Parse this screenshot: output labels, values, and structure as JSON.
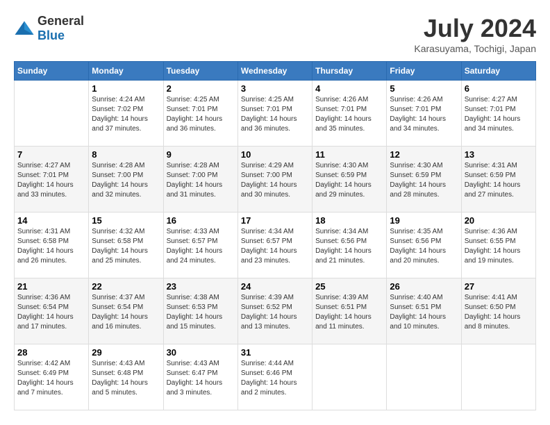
{
  "logo": {
    "general": "General",
    "blue": "Blue"
  },
  "title": "July 2024",
  "subtitle": "Karasuyama, Tochigi, Japan",
  "days": [
    "Sunday",
    "Monday",
    "Tuesday",
    "Wednesday",
    "Thursday",
    "Friday",
    "Saturday"
  ],
  "weeks": [
    [
      {
        "date": "",
        "info": ""
      },
      {
        "date": "1",
        "info": "Sunrise: 4:24 AM\nSunset: 7:02 PM\nDaylight: 14 hours\nand 37 minutes."
      },
      {
        "date": "2",
        "info": "Sunrise: 4:25 AM\nSunset: 7:01 PM\nDaylight: 14 hours\nand 36 minutes."
      },
      {
        "date": "3",
        "info": "Sunrise: 4:25 AM\nSunset: 7:01 PM\nDaylight: 14 hours\nand 36 minutes."
      },
      {
        "date": "4",
        "info": "Sunrise: 4:26 AM\nSunset: 7:01 PM\nDaylight: 14 hours\nand 35 minutes."
      },
      {
        "date": "5",
        "info": "Sunrise: 4:26 AM\nSunset: 7:01 PM\nDaylight: 14 hours\nand 34 minutes."
      },
      {
        "date": "6",
        "info": "Sunrise: 4:27 AM\nSunset: 7:01 PM\nDaylight: 14 hours\nand 34 minutes."
      }
    ],
    [
      {
        "date": "7",
        "info": "Sunrise: 4:27 AM\nSunset: 7:01 PM\nDaylight: 14 hours\nand 33 minutes."
      },
      {
        "date": "8",
        "info": "Sunrise: 4:28 AM\nSunset: 7:00 PM\nDaylight: 14 hours\nand 32 minutes."
      },
      {
        "date": "9",
        "info": "Sunrise: 4:28 AM\nSunset: 7:00 PM\nDaylight: 14 hours\nand 31 minutes."
      },
      {
        "date": "10",
        "info": "Sunrise: 4:29 AM\nSunset: 7:00 PM\nDaylight: 14 hours\nand 30 minutes."
      },
      {
        "date": "11",
        "info": "Sunrise: 4:30 AM\nSunset: 6:59 PM\nDaylight: 14 hours\nand 29 minutes."
      },
      {
        "date": "12",
        "info": "Sunrise: 4:30 AM\nSunset: 6:59 PM\nDaylight: 14 hours\nand 28 minutes."
      },
      {
        "date": "13",
        "info": "Sunrise: 4:31 AM\nSunset: 6:59 PM\nDaylight: 14 hours\nand 27 minutes."
      }
    ],
    [
      {
        "date": "14",
        "info": "Sunrise: 4:31 AM\nSunset: 6:58 PM\nDaylight: 14 hours\nand 26 minutes."
      },
      {
        "date": "15",
        "info": "Sunrise: 4:32 AM\nSunset: 6:58 PM\nDaylight: 14 hours\nand 25 minutes."
      },
      {
        "date": "16",
        "info": "Sunrise: 4:33 AM\nSunset: 6:57 PM\nDaylight: 14 hours\nand 24 minutes."
      },
      {
        "date": "17",
        "info": "Sunrise: 4:34 AM\nSunset: 6:57 PM\nDaylight: 14 hours\nand 23 minutes."
      },
      {
        "date": "18",
        "info": "Sunrise: 4:34 AM\nSunset: 6:56 PM\nDaylight: 14 hours\nand 21 minutes."
      },
      {
        "date": "19",
        "info": "Sunrise: 4:35 AM\nSunset: 6:56 PM\nDaylight: 14 hours\nand 20 minutes."
      },
      {
        "date": "20",
        "info": "Sunrise: 4:36 AM\nSunset: 6:55 PM\nDaylight: 14 hours\nand 19 minutes."
      }
    ],
    [
      {
        "date": "21",
        "info": "Sunrise: 4:36 AM\nSunset: 6:54 PM\nDaylight: 14 hours\nand 17 minutes."
      },
      {
        "date": "22",
        "info": "Sunrise: 4:37 AM\nSunset: 6:54 PM\nDaylight: 14 hours\nand 16 minutes."
      },
      {
        "date": "23",
        "info": "Sunrise: 4:38 AM\nSunset: 6:53 PM\nDaylight: 14 hours\nand 15 minutes."
      },
      {
        "date": "24",
        "info": "Sunrise: 4:39 AM\nSunset: 6:52 PM\nDaylight: 14 hours\nand 13 minutes."
      },
      {
        "date": "25",
        "info": "Sunrise: 4:39 AM\nSunset: 6:51 PM\nDaylight: 14 hours\nand 11 minutes."
      },
      {
        "date": "26",
        "info": "Sunrise: 4:40 AM\nSunset: 6:51 PM\nDaylight: 14 hours\nand 10 minutes."
      },
      {
        "date": "27",
        "info": "Sunrise: 4:41 AM\nSunset: 6:50 PM\nDaylight: 14 hours\nand 8 minutes."
      }
    ],
    [
      {
        "date": "28",
        "info": "Sunrise: 4:42 AM\nSunset: 6:49 PM\nDaylight: 14 hours\nand 7 minutes."
      },
      {
        "date": "29",
        "info": "Sunrise: 4:43 AM\nSunset: 6:48 PM\nDaylight: 14 hours\nand 5 minutes."
      },
      {
        "date": "30",
        "info": "Sunrise: 4:43 AM\nSunset: 6:47 PM\nDaylight: 14 hours\nand 3 minutes."
      },
      {
        "date": "31",
        "info": "Sunrise: 4:44 AM\nSunset: 6:46 PM\nDaylight: 14 hours\nand 2 minutes."
      },
      {
        "date": "",
        "info": ""
      },
      {
        "date": "",
        "info": ""
      },
      {
        "date": "",
        "info": ""
      }
    ]
  ]
}
